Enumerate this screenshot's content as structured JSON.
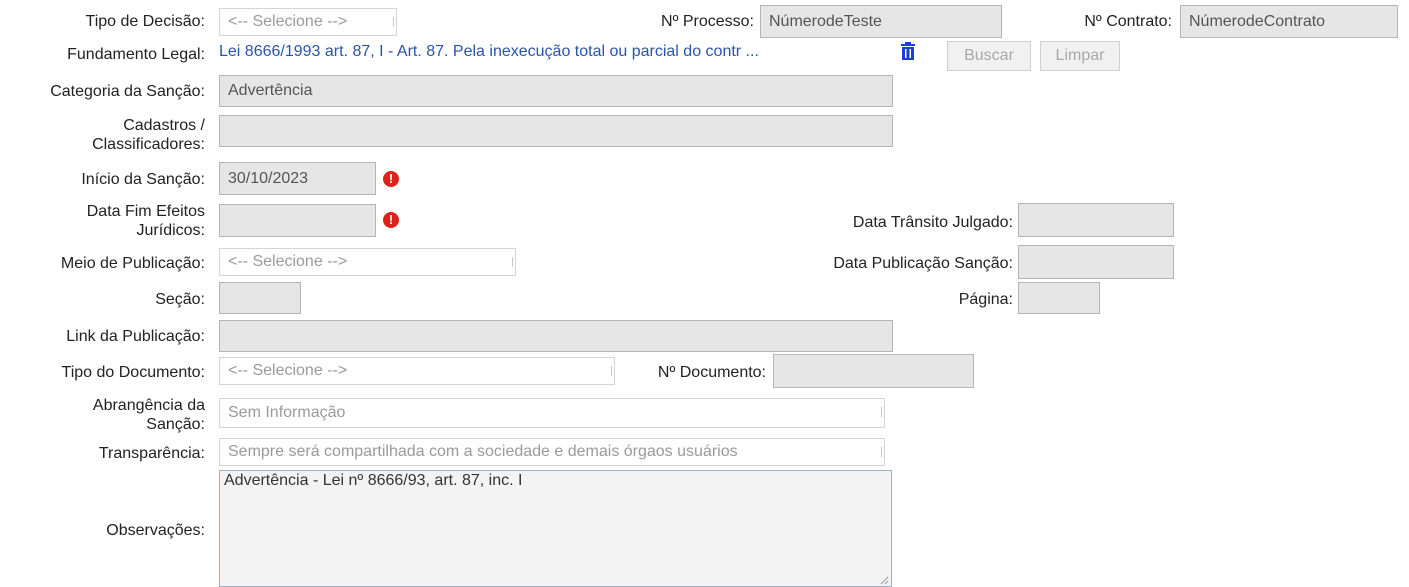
{
  "tipo_decisao": {
    "label": "Tipo de Decisão:",
    "value": "<-- Selecione -->"
  },
  "processo": {
    "label": "Nº Processo:",
    "value": "NúmerodeTeste"
  },
  "contrato": {
    "label": "Nº Contrato:",
    "value": "NúmerodeContrato"
  },
  "fundamento": {
    "label": "Fundamento Legal:",
    "value": "Lei 8666/1993 art. 87, I - Art. 87. Pela inexecução total ou parcial do contr ...",
    "delete_icon": "trash-icon"
  },
  "buttons": {
    "buscar": "Buscar",
    "limpar": "Limpar"
  },
  "categoria": {
    "label": "Categoria da Sanção:",
    "value": "Advertência"
  },
  "cadastros": {
    "label_line1": "Cadastros /",
    "label_line2": "Classificadores:",
    "value": ""
  },
  "inicio": {
    "label": "Início da Sanção:",
    "value": "30/10/2023",
    "alert_icon": "exclamation-icon",
    "alert_glyph": "!"
  },
  "data_fim": {
    "label_line1": "Data Fim Efeitos",
    "label_line2": "Jurídicos:",
    "value": "",
    "alert_glyph": "!"
  },
  "transito": {
    "label": "Data Trânsito Julgado:",
    "value": ""
  },
  "meio_publicacao": {
    "label": "Meio de Publicação:",
    "value": "<-- Selecione -->"
  },
  "data_publicacao": {
    "label": "Data Publicação Sanção:",
    "value": ""
  },
  "secao": {
    "label": "Seção:",
    "value": ""
  },
  "pagina": {
    "label": "Página:",
    "value": ""
  },
  "link_publicacao": {
    "label": "Link da Publicação:",
    "value": ""
  },
  "tipo_documento": {
    "label": "Tipo do Documento:",
    "value": "<-- Selecione -->"
  },
  "num_documento": {
    "label": "Nº Documento:",
    "value": ""
  },
  "abrangencia": {
    "label_line1": "Abrangência da",
    "label_line2": "Sanção:",
    "value": "Sem Informação"
  },
  "transparencia": {
    "label": "Transparência:",
    "value": "Sempre será compartilhada com a sociedade e demais órgaos usuários"
  },
  "observacoes": {
    "label": "Observações:",
    "value": "Advertência - Lei nº 8666/93, art. 87, inc. I"
  },
  "colors": {
    "link": "#2a55a6",
    "alert": "#e0201a",
    "readonly_bg": "#e6e6e6"
  }
}
